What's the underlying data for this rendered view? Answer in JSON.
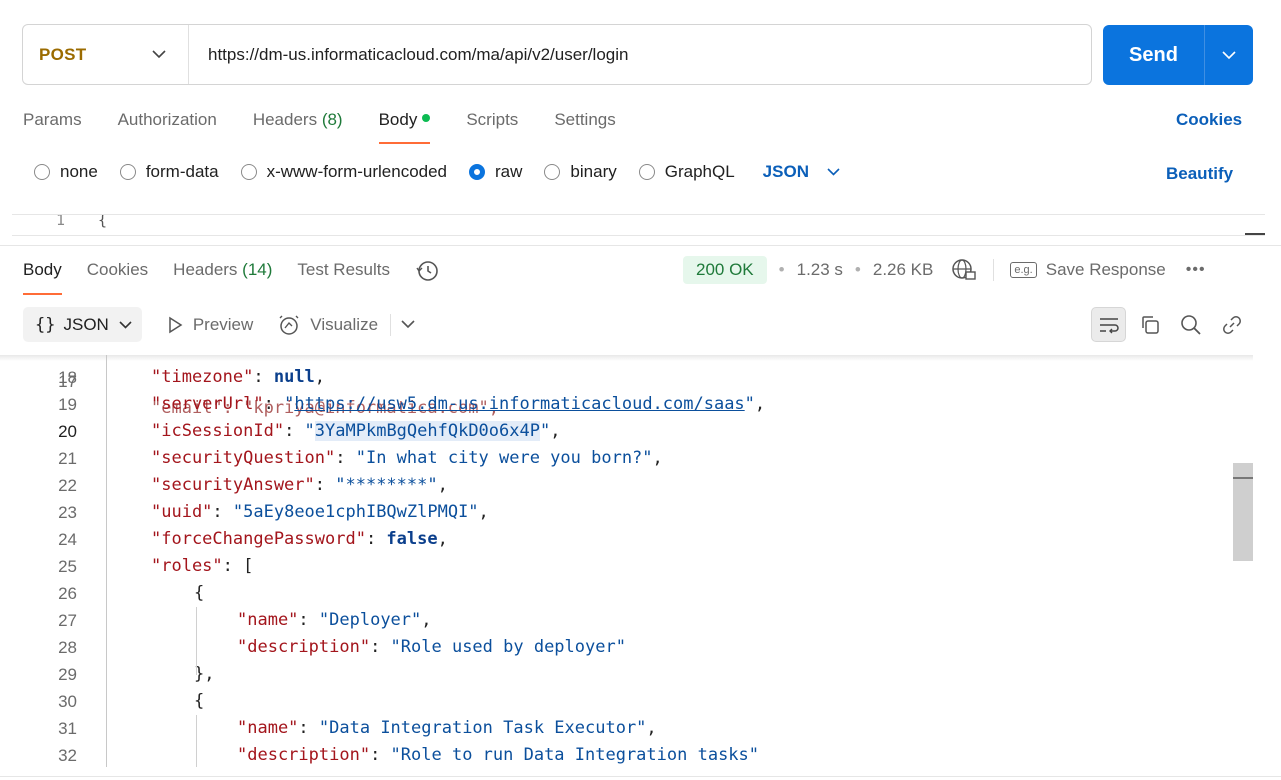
{
  "request": {
    "method": "POST",
    "url": "https://dm-us.informaticacloud.com/ma/api/v2/user/login",
    "send_label": "Send"
  },
  "request_tabs": [
    {
      "label": "Params"
    },
    {
      "label": "Authorization"
    },
    {
      "label": "Headers",
      "count": "(8)"
    },
    {
      "label": "Body"
    },
    {
      "label": "Scripts"
    },
    {
      "label": "Settings"
    }
  ],
  "cookies_label": "Cookies",
  "body_types": [
    "none",
    "form-data",
    "x-www-form-urlencoded",
    "raw",
    "binary",
    "GraphQL"
  ],
  "body_selected": "raw",
  "body_format": "JSON",
  "beautify_label": "Beautify",
  "editor_preview": {
    "line": "1",
    "text": "{"
  },
  "response_tabs": [
    {
      "label": "Body"
    },
    {
      "label": "Cookies"
    },
    {
      "label": "Headers",
      "count": "(14)"
    },
    {
      "label": "Test Results"
    }
  ],
  "response_meta": {
    "status": "200 OK",
    "time": "1.23 s",
    "size": "2.26 KB",
    "save_label": "Save Response",
    "eg_label": "e.g."
  },
  "view": {
    "format": "JSON",
    "preview_label": "Preview",
    "visualize_label": "Visualize"
  },
  "code": {
    "partial_top": {
      "line": "17",
      "text": "\"email\": \"kpriya@informatica.com\","
    },
    "current_line": "20",
    "lines": [
      {
        "n": "18",
        "key": "timezone",
        "val": "null",
        "vt": "kw",
        "tail": ","
      },
      {
        "n": "19",
        "key": "serverUrl",
        "val": "https://usw5.dm-us.informaticacloud.com/saas",
        "vt": "url",
        "tail": ","
      },
      {
        "n": "20",
        "key": "icSessionId",
        "val": "3YaMPkmBgQehfQkD0o6x4P",
        "vt": "hl",
        "tail": ","
      },
      {
        "n": "21",
        "key": "securityQuestion",
        "val": "In what city were you born?",
        "vt": "str",
        "tail": ","
      },
      {
        "n": "22",
        "key": "securityAnswer",
        "val": "********",
        "vt": "str",
        "tail": ","
      },
      {
        "n": "23",
        "key": "uuid",
        "val": "5aEy8eoe1cphIBQwZlPMQI",
        "vt": "str",
        "tail": ","
      },
      {
        "n": "24",
        "key": "forceChangePassword",
        "val": "false",
        "vt": "kw",
        "tail": ","
      },
      {
        "n": "25",
        "key": "roles",
        "val": "",
        "vt": "open",
        "tail": "["
      },
      {
        "n": "26",
        "text": "{",
        "indent": 2
      },
      {
        "n": "27",
        "key": "name",
        "val": "Deployer",
        "vt": "str",
        "tail": ",",
        "indent": 3
      },
      {
        "n": "28",
        "key": "description",
        "val": "Role used by deployer",
        "vt": "str",
        "tail": "",
        "indent": 3
      },
      {
        "n": "29",
        "text": "},",
        "indent": 2
      },
      {
        "n": "30",
        "text": "{",
        "indent": 2
      },
      {
        "n": "31",
        "key": "name",
        "val": "Data Integration Task Executor",
        "vt": "str",
        "tail": ",",
        "indent": 3
      },
      {
        "n": "32",
        "key": "description",
        "val": "Role to run Data Integration tasks",
        "vt": "str",
        "tail": "",
        "indent": 3
      }
    ]
  }
}
